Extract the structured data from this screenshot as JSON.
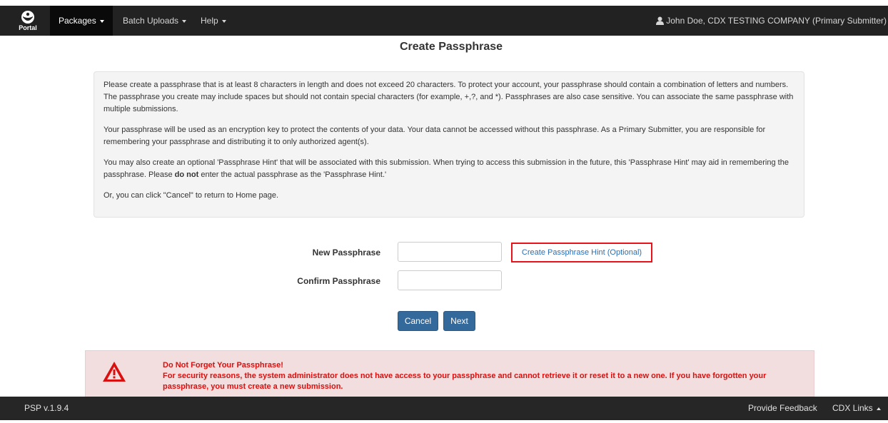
{
  "navbar": {
    "brand_label": "Portal",
    "brand_icon": "portal-logo-icon",
    "items": [
      {
        "label": "Packages"
      },
      {
        "label": "Batch Uploads"
      },
      {
        "label": "Help"
      }
    ],
    "user_icon": "user-icon",
    "user": "John Doe, CDX TESTING COMPANY (Primary Submitter)"
  },
  "page": {
    "title": "Create Passphrase"
  },
  "info": {
    "p1": "Please create a passphrase that is at least 8 characters in length and does not exceed 20 characters. To protect your account, your passphrase should contain a combination of letters and numbers. The passphrase you create may include spaces but should not contain special characters (for example, +,?, and *). Passphrases are also case sensitive. You can associate the same passphrase with multiple submissions.",
    "p2": "Your passphrase will be used as an encryption key to protect the contents of your data. Your data cannot be accessed without this passphrase. As a Primary Submitter, you are responsible for remembering your passphrase and distributing it to only authorized agent(s).",
    "p3_before": "You may also create an optional 'Passphrase Hint' that will be associated with this submission. When trying to access this submission in the future, this 'Passphrase Hint' may aid in remembering the passphrase. Please ",
    "p3_bold": "do not",
    "p3_after": " enter the actual passphrase as the 'Passphrase Hint.'",
    "p4": "Or, you can click \"Cancel\" to return to Home page."
  },
  "form": {
    "new_label": "New Passphrase",
    "new_value": "",
    "confirm_label": "Confirm Passphrase",
    "confirm_value": "",
    "hint_link": "Create Passphrase Hint (Optional)",
    "cancel": "Cancel",
    "next": "Next"
  },
  "alert": {
    "icon": "warning-icon",
    "title": "Do Not Forget Your Passphrase!",
    "body": "For security reasons, the system administrator does not have access to your passphrase and cannot retrieve it or reset it to a new one. If you have forgotten your passphrase, you must create a new submission.",
    "color": "#d9100f"
  },
  "footer": {
    "version": "PSP  v.1.9.4",
    "feedback": "Provide Feedback",
    "cdx_links": "CDX Links"
  }
}
